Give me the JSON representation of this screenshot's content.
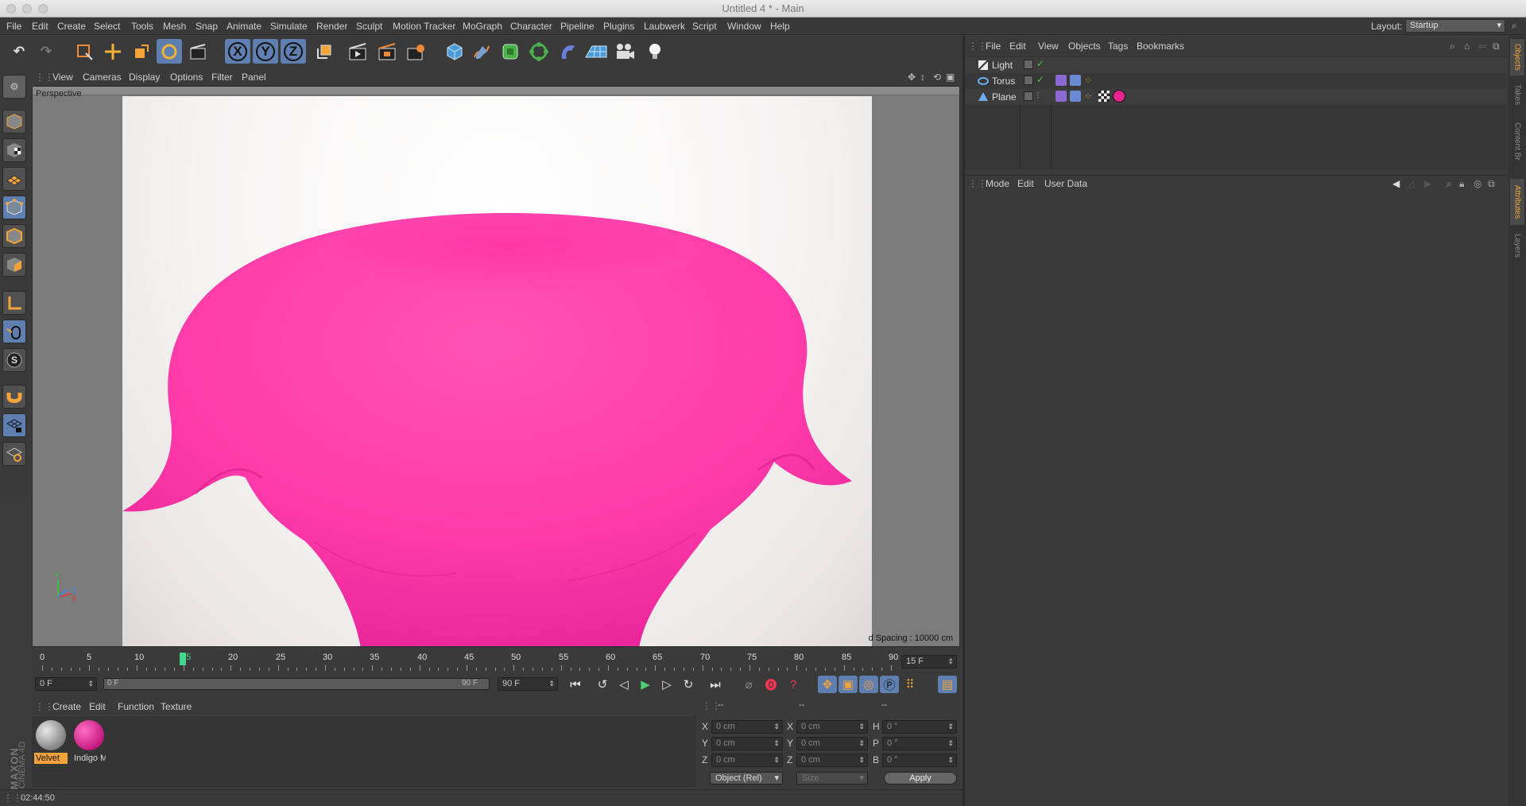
{
  "window": {
    "title": "Untitled 4 * - Main"
  },
  "menubar": {
    "items": [
      "File",
      "Edit",
      "Create",
      "Select",
      "Tools",
      "Mesh",
      "Snap",
      "Animate",
      "Simulate",
      "Render",
      "Sculpt",
      "Motion Tracker",
      "MoGraph",
      "Character",
      "Pipeline",
      "Plugins",
      "Laubwerk",
      "Script",
      "Window",
      "Help"
    ],
    "layout_label": "Layout:",
    "layout_value": "Startup"
  },
  "toolbar": {
    "axis_x": "X",
    "axis_y": "Y",
    "axis_z": "Z"
  },
  "viewport": {
    "menu": [
      "View",
      "Cameras",
      "Display",
      "Options",
      "Filter",
      "Panel"
    ],
    "label": "Perspective",
    "grid_spacing": "d Spacing : 10000 cm",
    "axis_y": "Y",
    "axis_x": "X",
    "axis_z": "Z"
  },
  "colors": {
    "torus": "#ff3aa8",
    "accent": "#5e7fb0",
    "selected_mat": "#f2a33a"
  },
  "timeline": {
    "ticks": [
      "0",
      "5",
      "10",
      "15",
      "20",
      "25",
      "30",
      "35",
      "40",
      "45",
      "50",
      "55",
      "60",
      "65",
      "70",
      "75",
      "80",
      "85",
      "90"
    ],
    "current_frame_field": "15 F",
    "current_tick": "15"
  },
  "transport": {
    "start_field": "0 F",
    "range_start": "0 F",
    "range_end": "90 F",
    "end_field": "90 F"
  },
  "materials": {
    "menu": [
      "Create",
      "Edit",
      "Function",
      "Texture"
    ],
    "items": [
      {
        "name": "Velvet",
        "selected": true
      },
      {
        "name": "Indigo M",
        "selected": false
      }
    ]
  },
  "coordinates": {
    "headers": [
      "--",
      "--",
      "--"
    ],
    "rows": [
      {
        "a_label": "X",
        "a_val": "0 cm",
        "b_label": "X",
        "b_val": "0 cm",
        "c_label": "H",
        "c_val": "0 °"
      },
      {
        "a_label": "Y",
        "a_val": "0 cm",
        "b_label": "Y",
        "b_val": "0 cm",
        "c_label": "P",
        "c_val": "0 °"
      },
      {
        "a_label": "Z",
        "a_val": "0 cm",
        "b_label": "Z",
        "b_val": "0 cm",
        "c_label": "B",
        "c_val": "0 °"
      }
    ],
    "mode_select": "Object (Rel)",
    "size_select": "Size",
    "apply": "Apply"
  },
  "status": {
    "time": "02:44:50"
  },
  "brand": {
    "line1": "MAXON",
    "line2": "CINEMA 4D"
  },
  "objects": {
    "menu": [
      "File",
      "Edit",
      "View",
      "Objects",
      "Tags",
      "Bookmarks"
    ],
    "rows": [
      {
        "name": "Light",
        "icon": "light-icon"
      },
      {
        "name": "Torus",
        "icon": "torus-icon"
      },
      {
        "name": "Plane",
        "icon": "plane-icon"
      }
    ]
  },
  "attributes": {
    "menu": [
      "Mode",
      "Edit",
      "User Data"
    ]
  },
  "side_tabs": [
    "Objects",
    "Takes",
    "Content Br",
    "Attributes",
    "Layers"
  ]
}
